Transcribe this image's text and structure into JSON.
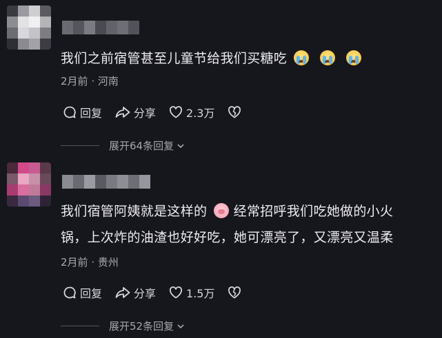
{
  "comments": [
    {
      "text": "我们之前宿管甚至儿童节给我们买糖吃",
      "text_line2": "",
      "emojis": [
        "crying-face",
        "crying-face",
        "crying-face"
      ],
      "time": "2月前",
      "location": "河南",
      "reply_label": "回复",
      "share_label": "分享",
      "likes": "2.3万",
      "replies_label": "展开64条回复"
    },
    {
      "text_before_emoji": "我们宿管阿姨就是这样的",
      "emoji": "pig-face",
      "text_after_emoji": "经常招呼我们吃她做的小火",
      "text_line2": "锅，上次炸的油渣也好好吃，她可漂亮了，又漂亮又温柔",
      "time": "2月前",
      "location": "贵州",
      "reply_label": "回复",
      "share_label": "分享",
      "likes": "1.5万",
      "replies_label": "展开52条回复"
    }
  ],
  "meta_separator": "·",
  "colors": {
    "background": "#16161d",
    "text": "#ececf0",
    "secondary": "#a9a9b2"
  },
  "icons": [
    "comment-bubble-icon",
    "share-arrow-icon",
    "heart-icon",
    "broken-heart-icon",
    "chevron-down-icon"
  ]
}
